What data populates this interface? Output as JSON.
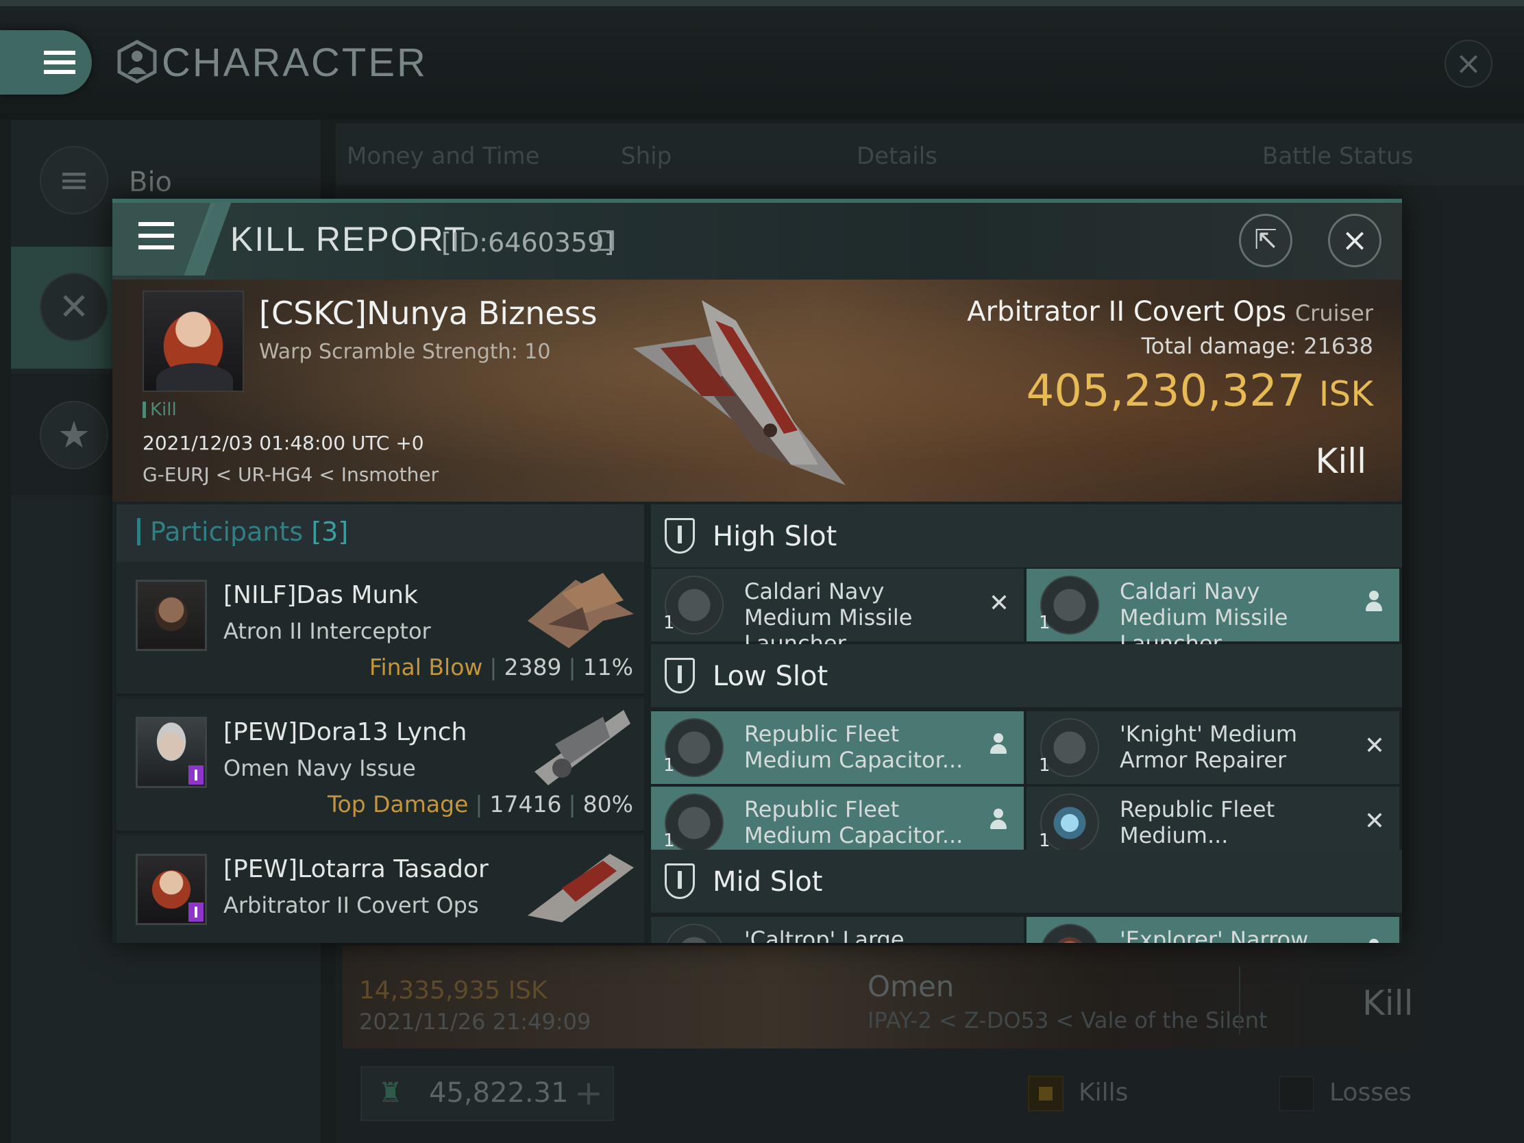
{
  "background": {
    "window_title": "CHARACTER",
    "sidebar": {
      "bio_label": "Bio"
    },
    "tabs": [
      "Money and Time",
      "Ship",
      "Details",
      "Battle Status"
    ],
    "row": {
      "isk": "14,335,935 ISK",
      "date": "2021/11/26 21:49:09",
      "ship": "Omen",
      "location": "IPAY-2 < Z-DO53 < Vale of the Silent",
      "outcome": "Kill"
    },
    "balance": "45,822.31",
    "filters": {
      "kills": "Kills",
      "losses": "Losses"
    }
  },
  "modal": {
    "title": "KILL REPORT",
    "id": "[ID:6460359]",
    "victim": {
      "name": "[CSKC]Nunya Bizness",
      "warp_scramble": "Warp Scramble Strength: 10",
      "tag": "Kill",
      "datetime": "2021/12/03 01:48:00 UTC +0",
      "location": "G-EURJ < UR-HG4 < Insmother"
    },
    "ship": {
      "name": "Arbitrator II Covert Ops",
      "class": "Cruiser",
      "total_damage_label": "Total damage:",
      "total_damage": "21638",
      "isk_value": "405,230,327",
      "isk_unit": "ISK",
      "outcome": "Kill"
    },
    "participants": {
      "title": "Participants",
      "count": "[3]",
      "list": [
        {
          "name": "[NILF]Das Munk",
          "ship": "Atron II Interceptor",
          "label": "Final Blow",
          "damage": "2389",
          "percent": "11%"
        },
        {
          "name": "[PEW]Dora13 Lynch",
          "ship": "Omen Navy Issue",
          "label": "Top Damage",
          "damage": "17416",
          "percent": "80%"
        },
        {
          "name": "[PEW]Lotarra Tasador",
          "ship": "Arbitrator II Covert Ops",
          "label": "",
          "damage": "",
          "percent": ""
        }
      ]
    },
    "slots": {
      "high": {
        "label": "High Slot",
        "modules": [
          {
            "qty": "1",
            "name": "Caldari Navy Medium Missile Launcher",
            "status": "destroyed",
            "icon": "missile-launcher-icon"
          },
          {
            "qty": "1",
            "name": "Caldari Navy Medium Missile Launcher",
            "status": "dropped",
            "icon": "missile-launcher-icon"
          }
        ]
      },
      "low": {
        "label": "Low Slot",
        "modules": [
          {
            "qty": "1",
            "name": "Republic Fleet Medium Capacitor...",
            "status": "dropped",
            "icon": "capacitor-booster-icon"
          },
          {
            "qty": "1",
            "name": "'Knight' Medium Armor Repairer",
            "status": "destroyed",
            "icon": "armor-repairer-icon"
          },
          {
            "qty": "1",
            "name": "Republic Fleet Medium Capacitor...",
            "status": "dropped",
            "icon": "capacitor-booster-icon"
          },
          {
            "qty": "1",
            "name": "Republic Fleet Medium...",
            "status": "destroyed",
            "icon": "energy-module-icon"
          }
        ]
      },
      "mid": {
        "label": "Mid Slot",
        "modules": [
          {
            "qty": "",
            "name": "'Caltrop' Large",
            "status": "destroyed",
            "icon": "warp-disruptor-icon"
          },
          {
            "qty": "",
            "name": "'Explorer' Narrow",
            "status": "dropped",
            "icon": "scanner-icon"
          }
        ]
      }
    }
  },
  "colors": {
    "accent": "#4a7873",
    "isk": "#e6ba55",
    "highlight": "#c4953b",
    "participants": "#2f7f84"
  }
}
